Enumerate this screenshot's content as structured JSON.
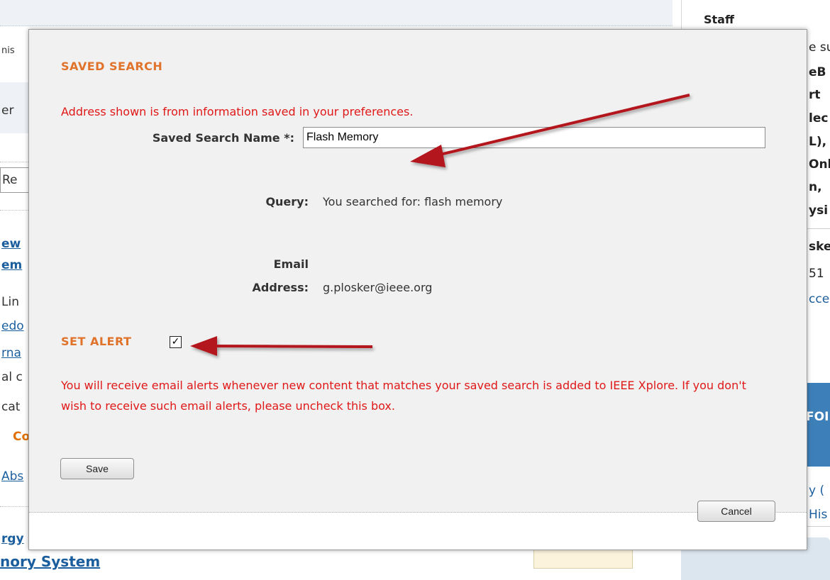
{
  "background": {
    "staff_label": "Staff",
    "right_fragments": [
      "e su",
      "eB",
      "rt",
      "lec",
      "L),",
      "Onl",
      "n,",
      "ysi",
      "ske",
      "51",
      "cce",
      "FOI",
      "y (",
      "His"
    ],
    "left_fragments": [
      "nis",
      "er",
      "Re",
      "ew",
      "em",
      "Lin",
      "edo",
      "rna",
      "al c",
      "cat",
      "Co",
      "Abs",
      "rgy"
    ],
    "bottom_link": "nory System"
  },
  "dialog": {
    "title": "SAVED SEARCH",
    "info_text": "Address shown is from information saved in your preferences.",
    "name_label": "Saved Search Name *:",
    "name_value": "Flash Memory",
    "query_label": "Query:",
    "query_value": "You searched for: flash memory",
    "email_label_line1": "Email",
    "email_label_line2": "Address:",
    "email_value": "g.plosker@ieee.org",
    "alert_title": "SET ALERT",
    "alert_checked": true,
    "alert_message": "You will receive email alerts whenever new content that matches your saved search is added to IEEE Xplore. If you don't wish to receive such email alerts, please uncheck this box.",
    "save_label": "Save",
    "cancel_label": "Cancel"
  },
  "colors": {
    "accent_orange": "#e0722a",
    "notice_red": "#e01818",
    "arrow_red": "#b3161d",
    "link_blue": "#1b5e9e"
  }
}
